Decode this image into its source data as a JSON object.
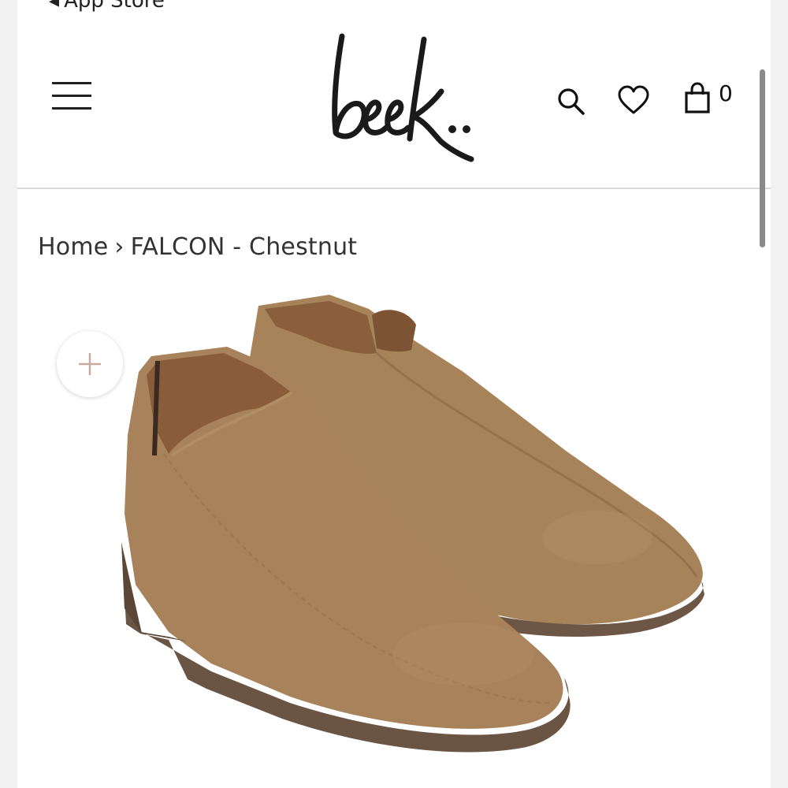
{
  "status_bar": {
    "back_label": "App Store"
  },
  "header": {
    "logo_text": "beek..",
    "cart_count": "0",
    "icons": [
      "menu-icon",
      "search-icon",
      "heart-icon",
      "bag-icon"
    ]
  },
  "breadcrumb": {
    "home": "Home",
    "separator": "›",
    "current": "FALCON - Chestnut"
  },
  "product": {
    "image_alt": "FALCON - Chestnut"
  },
  "colors": {
    "accent": "#222222",
    "suede": "#a8825a",
    "sole": "#6a5545"
  }
}
